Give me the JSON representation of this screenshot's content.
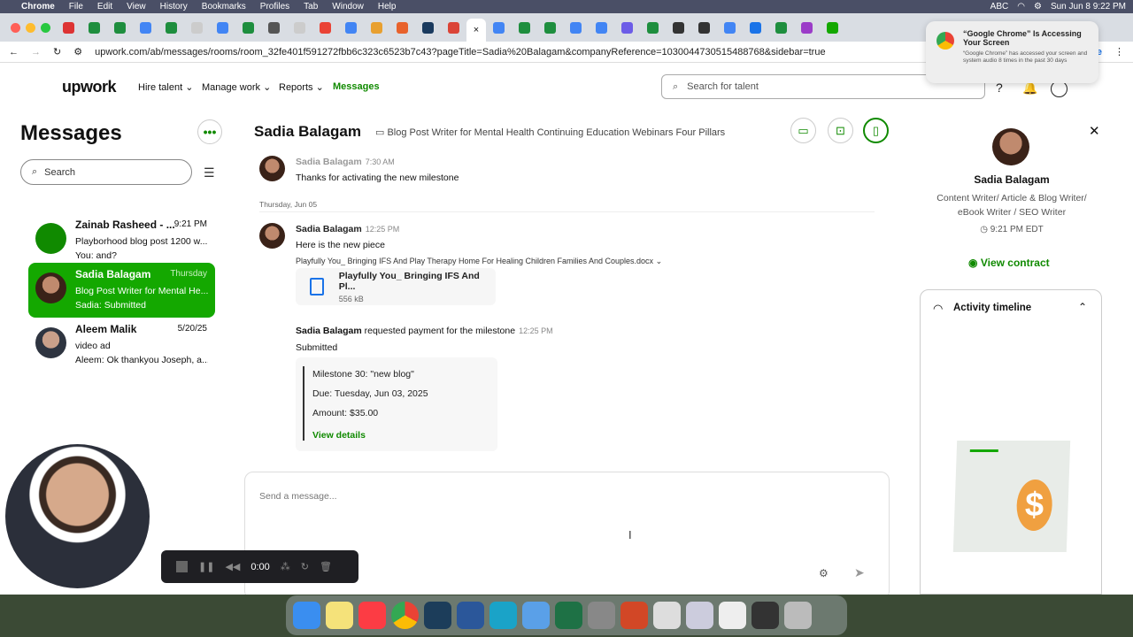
{
  "menubar": {
    "app": "Chrome",
    "items": [
      "File",
      "Edit",
      "View",
      "History",
      "Bookmarks",
      "Profiles",
      "Tab",
      "Window",
      "Help"
    ],
    "abc": "ABC",
    "datetime": "Sun Jun 8  9:22 PM"
  },
  "tab": {
    "close": "×"
  },
  "address": {
    "url": "upwork.com/ab/messages/rooms/room_32fe401f591272fbb6c323c6523b7c43?pageTitle=Sadia%20Balagam&companyReference=1030044730515488768&sidebar=true",
    "update": "date"
  },
  "nav": {
    "logo": "upwork",
    "hire": "Hire talent",
    "manage": "Manage work",
    "reports": "Reports",
    "messages": "Messages",
    "search_placeholder": "Search for talent"
  },
  "sidebar": {
    "title": "Messages",
    "search_placeholder": "Search",
    "conversations": [
      {
        "name": "Zainab Rasheed - ...",
        "date": "9:21 PM",
        "line1": "Playborhood blog post 1200 w...",
        "line2": "You: and?"
      },
      {
        "name": "Sadia Balagam",
        "date": "Thursday",
        "line1": "Blog Post Writer for Mental He...",
        "line2": "Sadia: Submitted"
      },
      {
        "name": "Aleem Malik",
        "date": "5/20/25",
        "line1": "video ad",
        "line2": "Aleem: Ok thankyou Joseph, a..."
      }
    ]
  },
  "chat": {
    "name": "Sadia Balagam",
    "subtitle": "Blog Post Writer for Mental Health Continuing Education Webinars Four Pillars",
    "msg1": {
      "sender": "Sadia Balagam",
      "time": "7:30 AM",
      "text": "Thanks for activating the new milestone"
    },
    "separator": "Thursday, Jun 05",
    "msg2": {
      "sender": "Sadia Balagam",
      "time": "12:25 PM",
      "text": "Here is the new piece",
      "attachment": "Playfully You_ Bringing IFS And Play Therapy Home For Healing Children Families And Couples.docx"
    },
    "file": {
      "name": "Playfully You_ Bringing IFS And Pl...",
      "size": "556 kB"
    },
    "msg3": {
      "sender": "Sadia Balagam",
      "action": "requested payment for the milestone",
      "time": "12:25 PM",
      "text": "Submitted"
    },
    "milestone": {
      "title": "Milestone 30: \"new blog\"",
      "due": "Due: Tuesday, Jun 03, 2025",
      "amount": "Amount: $35.00",
      "link": "View details"
    },
    "composer_placeholder": "Send a message..."
  },
  "profile": {
    "name": "Sadia Balagam",
    "title": "Content Writer/ Article & Blog Writer/ eBook Writer / SEO Writer",
    "time": "9:21 PM EDT",
    "contract": "View contract",
    "timeline": "Activity timeline"
  },
  "notification": {
    "title": "“Google Chrome” Is Accessing Your Screen",
    "body": "“Google Chrome” has accessed your screen and system audio 8 times in the past 30 days"
  },
  "recorder": {
    "time": "0:00"
  },
  "colors": {
    "accent": "#14a800",
    "link": "#108a00"
  }
}
